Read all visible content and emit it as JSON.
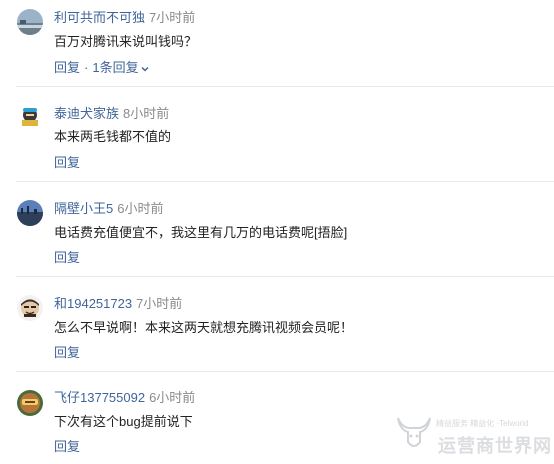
{
  "comments": [
    {
      "username": "利可共而不可独",
      "time": "7小时前",
      "text": "百万对腾讯来说叫钱吗？",
      "reply_label": "回复",
      "sep": "·",
      "replies_label": "1条回复"
    },
    {
      "username": "泰迪犬家族",
      "time": "8小时前",
      "text": "本来两毛钱都不值的",
      "reply_label": "回复"
    },
    {
      "username": "隔壁小王5",
      "time": "6小时前",
      "text": "电话费充值便宜不，我这里有几万的电话费呢[捂脸]",
      "reply_label": "回复"
    },
    {
      "username": "和194251723",
      "time": "7小时前",
      "text": "怎么不早说啊！本来这两天就想充腾讯视频会员呢！",
      "reply_label": "回复"
    },
    {
      "username": "飞仔137755092",
      "time": "6小时前",
      "text": "下次有这个bug提前说下",
      "reply_label": "回复"
    }
  ],
  "watermark": {
    "small": "精益服务 精益化  ·Telworld",
    "big": "运营商世界网"
  },
  "colors": {
    "username": "#406599",
    "time": "#8a8a8a",
    "text": "#222222",
    "divider": "#e8e8e8"
  }
}
